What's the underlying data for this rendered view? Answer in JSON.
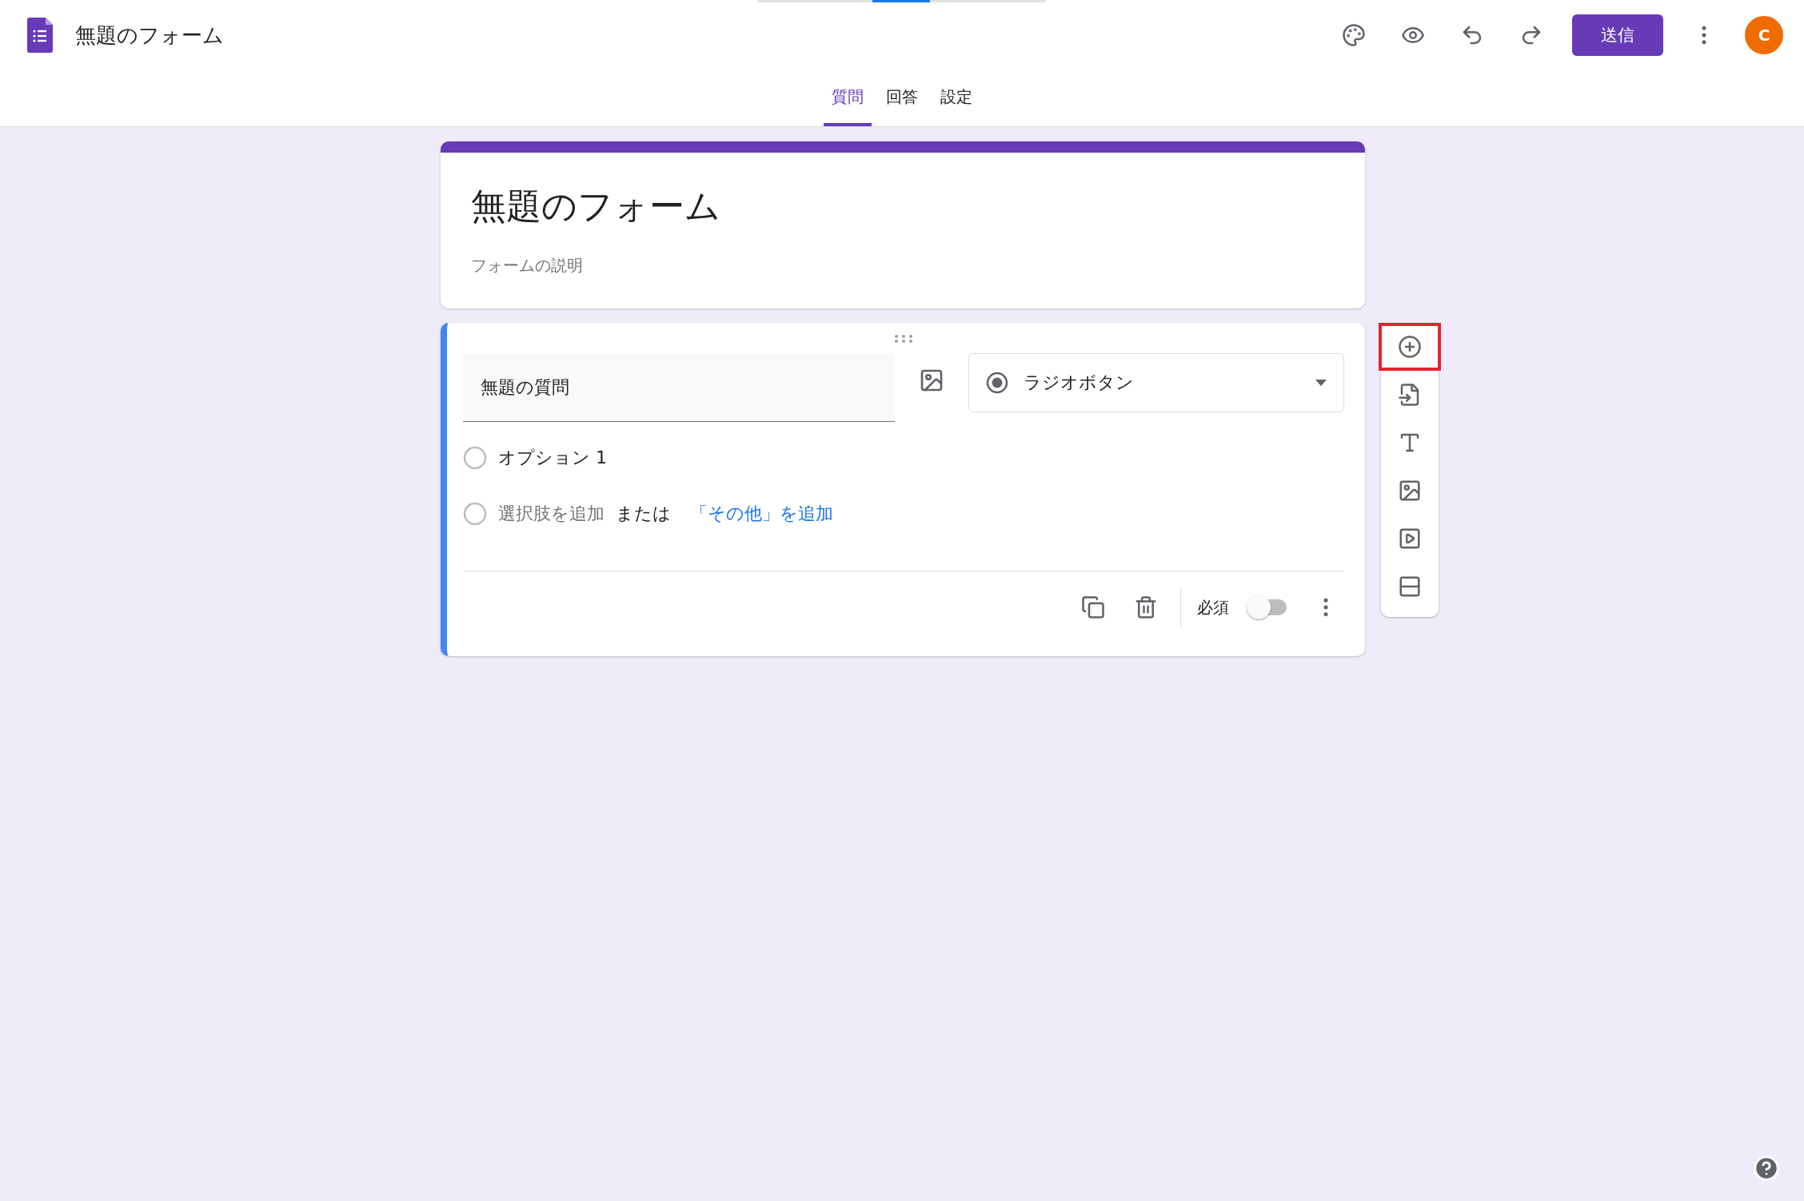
{
  "header": {
    "doc_title": "無題のフォーム",
    "send_button": "送信",
    "avatar_letter": "C"
  },
  "tabs": [
    {
      "label": "質問",
      "selected": true
    },
    {
      "label": "回答",
      "selected": false
    },
    {
      "label": "設定",
      "selected": false
    }
  ],
  "form_header": {
    "title": "無題のフォーム",
    "description": "フォームの説明"
  },
  "question": {
    "title": "無題の質問",
    "type": "ラジオボタン",
    "options": [
      {
        "label": "オプション 1",
        "selected": false
      }
    ],
    "add_option_selected": false,
    "add_option": "選択肢を追加",
    "or_text": "または",
    "add_other": "「その他」を追加",
    "required_label": "必須",
    "required": false
  },
  "toolbar": [
    {
      "kind": "add-question",
      "highlighted": true
    },
    {
      "kind": "import",
      "highlighted": false
    },
    {
      "kind": "title",
      "highlighted": false
    },
    {
      "kind": "image",
      "highlighted": false
    },
    {
      "kind": "video",
      "highlighted": false
    },
    {
      "kind": "section",
      "highlighted": false
    }
  ]
}
